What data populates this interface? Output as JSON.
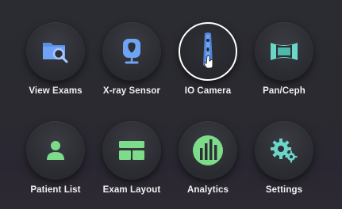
{
  "tiles": [
    {
      "label": "View Exams",
      "icon": "folder-search-icon",
      "color": "#6fa3f5"
    },
    {
      "label": "X-ray Sensor",
      "icon": "xray-sensor-icon",
      "color": "#6fa3f5"
    },
    {
      "label": "IO Camera",
      "icon": "intraoral-camera-icon",
      "color": "#6fa3f5",
      "selected": true
    },
    {
      "label": "Pan/Ceph",
      "icon": "panoramic-icon",
      "color": "#6cd6c8"
    },
    {
      "label": "Patient List",
      "icon": "person-icon",
      "color": "#7ddc8a"
    },
    {
      "label": "Exam Layout",
      "icon": "layout-grid-icon",
      "color": "#7ddc8a"
    },
    {
      "label": "Analytics",
      "icon": "bar-chart-icon",
      "color": "#7ddc8a"
    },
    {
      "label": "Settings",
      "icon": "gear-settings-icon",
      "color": "#6cd6c8"
    }
  ],
  "colors": {
    "background": "#2b2c31",
    "button": "#2e2f35",
    "label": "#f2f2f2",
    "selected_ring": "#ffffff"
  }
}
